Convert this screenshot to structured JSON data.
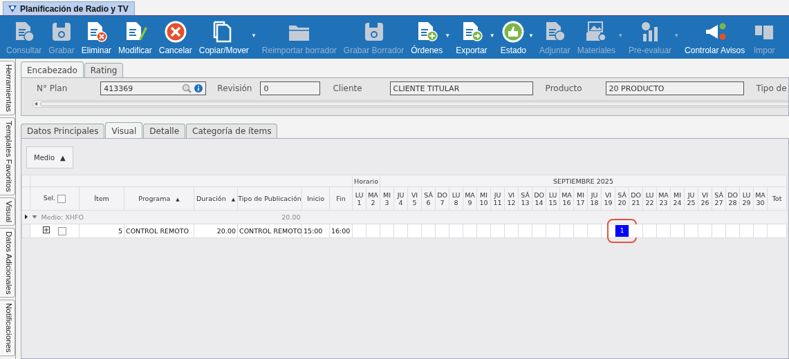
{
  "window": {
    "tab_title": "Planificación de Radio y TV"
  },
  "toolbar": [
    {
      "label": "Consultar",
      "kind": "doc-question",
      "disabled": true
    },
    {
      "label": "Grabar",
      "kind": "floppy",
      "disabled": true
    },
    {
      "label": "Eliminar",
      "kind": "doc-x",
      "disabled": false
    },
    {
      "label": "Modificar",
      "kind": "doc-pencil",
      "disabled": false
    },
    {
      "label": "Cancelar",
      "kind": "cancel",
      "disabled": false
    },
    {
      "label": "Copiar/Mover",
      "kind": "copy",
      "disabled": false,
      "caret": "▼"
    },
    {
      "label": "Reimportar borrador",
      "kind": "folder",
      "disabled": true
    },
    {
      "label": "Grabar Borrador",
      "kind": "floppy",
      "disabled": true
    },
    {
      "label": "Órdenes",
      "kind": "doc-plus",
      "disabled": false,
      "caret": "▼"
    },
    {
      "label": "Exportar",
      "kind": "doc-arrow",
      "disabled": false,
      "caret": "▼"
    },
    {
      "label": "Estado",
      "kind": "thumb",
      "disabled": false,
      "caret": "▼"
    },
    {
      "label": "Adjuntar",
      "kind": "doc-clip",
      "disabled": true
    },
    {
      "label": "Materiales",
      "kind": "media",
      "disabled": true,
      "caret": "▼"
    },
    {
      "label": "Pre-evaluar",
      "kind": "chart",
      "disabled": true,
      "caret": "▼"
    },
    {
      "label": "Controlar Avisos",
      "kind": "megaphone",
      "disabled": false
    },
    {
      "label": "Impor",
      "kind": "import",
      "disabled": true
    }
  ],
  "side_tabs": [
    "Herramientas",
    "Templates Favoritos",
    "Visual",
    "Datos Adicionales",
    "Notificaciones"
  ],
  "header_tabs": [
    {
      "label": "Encabezado",
      "selected": true
    },
    {
      "label": "Rating",
      "selected": false
    }
  ],
  "header_fields": [
    {
      "label": "N° Plan",
      "value": "413369",
      "kind": "lookup"
    },
    {
      "label": "Revisión",
      "value": "0",
      "kind": "text"
    },
    {
      "label": "Cliente",
      "value": "CLIENTE TITULAR",
      "kind": "text"
    },
    {
      "label": "Producto",
      "value": "20 PRODUCTO",
      "kind": "text"
    },
    {
      "label": "Tipo de",
      "kind": "cut"
    }
  ],
  "detail_tabs": [
    {
      "label": "Datos Principales",
      "selected": false
    },
    {
      "label": "Visual",
      "selected": true
    },
    {
      "label": "Detalle",
      "selected": false
    },
    {
      "label": "Categoría de ítems",
      "selected": false
    }
  ],
  "group_button": {
    "label": "Medio",
    "caret": "▲"
  },
  "grid": {
    "band_horario": "Horario",
    "band_month": "SEPTIEMBRE 2025",
    "sel_label": "Sel.",
    "sel_checked": false,
    "columns": [
      {
        "label": "Ítem"
      },
      {
        "label": "Programa",
        "sort_arrow": "▲"
      },
      {
        "label": "Duración",
        "sort_arrow": "▲"
      },
      {
        "label": "Tipo de Publicación"
      },
      {
        "label": "Inicio"
      },
      {
        "label": "Fin"
      }
    ],
    "days": [
      {
        "dow": "LU",
        "day": "1"
      },
      {
        "dow": "MA",
        "day": "2"
      },
      {
        "dow": "MI",
        "day": "3"
      },
      {
        "dow": "JU",
        "day": "4"
      },
      {
        "dow": "VI",
        "day": "5"
      },
      {
        "dow": "SÁ",
        "day": "6"
      },
      {
        "dow": "DO",
        "day": "7"
      },
      {
        "dow": "LU",
        "day": "8"
      },
      {
        "dow": "MA",
        "day": "9"
      },
      {
        "dow": "MI",
        "day": "10"
      },
      {
        "dow": "JU",
        "day": "11"
      },
      {
        "dow": "VI",
        "day": "12"
      },
      {
        "dow": "SÁ",
        "day": "13"
      },
      {
        "dow": "DO",
        "day": "14"
      },
      {
        "dow": "LU",
        "day": "15"
      },
      {
        "dow": "MA",
        "day": "16"
      },
      {
        "dow": "MI",
        "day": "17"
      },
      {
        "dow": "JU",
        "day": "18"
      },
      {
        "dow": "VI",
        "day": "19"
      },
      {
        "dow": "SÁ",
        "day": "20"
      },
      {
        "dow": "DO",
        "day": "21"
      },
      {
        "dow": "LU",
        "day": "22"
      },
      {
        "dow": "MA",
        "day": "23"
      },
      {
        "dow": "MI",
        "day": "24"
      },
      {
        "dow": "JU",
        "day": "25"
      },
      {
        "dow": "VI",
        "day": "26"
      },
      {
        "dow": "SÁ",
        "day": "27"
      },
      {
        "dow": "DO",
        "day": "28"
      },
      {
        "dow": "LU",
        "day": "29"
      },
      {
        "dow": "MA",
        "day": "30"
      }
    ],
    "total_label": "Tot",
    "group": {
      "label": "Medio: XHFO",
      "duration": "20.00",
      "expanded": true
    },
    "rows": [
      {
        "checked": false,
        "item": "5",
        "programa": "CONTROL REMOTO",
        "duracion": "20.00",
        "tipo": "CONTROL REMOTO",
        "inicio": "15:00",
        "fin": "16:00",
        "day_cells": [
          {
            "filled": false
          },
          {
            "filled": false
          },
          {
            "filled": false
          },
          {
            "filled": false
          },
          {
            "filled": false
          },
          {
            "filled": false
          },
          {
            "filled": false
          },
          {
            "filled": false
          },
          {
            "filled": false
          },
          {
            "filled": false
          },
          {
            "filled": false
          },
          {
            "filled": false
          },
          {
            "filled": false
          },
          {
            "filled": false
          },
          {
            "filled": false
          },
          {
            "filled": false
          },
          {
            "filled": false
          },
          {
            "filled": false
          },
          {
            "filled": false
          },
          {
            "filled": true,
            "value": "1",
            "circled": true
          },
          {
            "filled": false
          },
          {
            "filled": false
          },
          {
            "filled": false
          },
          {
            "filled": false
          },
          {
            "filled": false
          },
          {
            "filled": false
          },
          {
            "filled": false
          },
          {
            "filled": false
          },
          {
            "filled": false
          },
          {
            "filled": false
          }
        ]
      }
    ]
  }
}
